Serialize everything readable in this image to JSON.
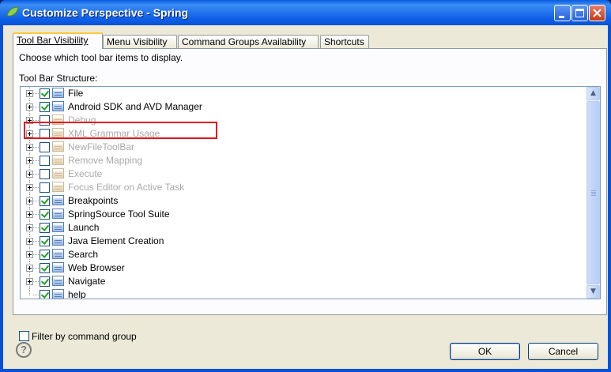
{
  "window": {
    "title": "Customize Perspective - Spring"
  },
  "tabs": [
    {
      "label": "Tool Bar Visibility",
      "active": true
    },
    {
      "label": "Menu Visibility",
      "active": false
    },
    {
      "label": "Command Groups Availability",
      "active": false
    },
    {
      "label": "Shortcuts",
      "active": false
    }
  ],
  "panel": {
    "instruction": "Choose which tool bar items to display.",
    "structure_label": "Tool Bar Structure:"
  },
  "tree": {
    "items": [
      {
        "label": "File",
        "checked": true,
        "enabled": true
      },
      {
        "label": "Android SDK and AVD Manager",
        "checked": true,
        "enabled": true
      },
      {
        "label": "Debug",
        "checked": false,
        "enabled": false
      },
      {
        "label": "XML Grammar Usage",
        "checked": false,
        "enabled": false
      },
      {
        "label": "NewFileToolBar",
        "checked": false,
        "enabled": false
      },
      {
        "label": "Remove Mapping",
        "checked": false,
        "enabled": false
      },
      {
        "label": "Execute",
        "checked": false,
        "enabled": false
      },
      {
        "label": "Focus Editor on Active Task",
        "checked": false,
        "enabled": false
      },
      {
        "label": "Breakpoints",
        "checked": true,
        "enabled": true
      },
      {
        "label": "SpringSource Tool Suite",
        "checked": true,
        "enabled": true
      },
      {
        "label": "Launch",
        "checked": true,
        "enabled": true
      },
      {
        "label": "Java Element Creation",
        "checked": true,
        "enabled": true
      },
      {
        "label": "Search",
        "checked": true,
        "enabled": true
      },
      {
        "label": "Web Browser",
        "checked": true,
        "enabled": true
      },
      {
        "label": "Navigate",
        "checked": true,
        "enabled": true
      },
      {
        "label": "help",
        "checked": true,
        "enabled": true
      }
    ]
  },
  "filter": {
    "label": "Filter by command group",
    "checked": false
  },
  "buttons": {
    "ok": "OK",
    "cancel": "Cancel",
    "help": "?"
  },
  "colors": {
    "title_bar": "#0a5ae0",
    "highlight_box": "#e3141b",
    "dialog_bg": "#ece9d8"
  }
}
